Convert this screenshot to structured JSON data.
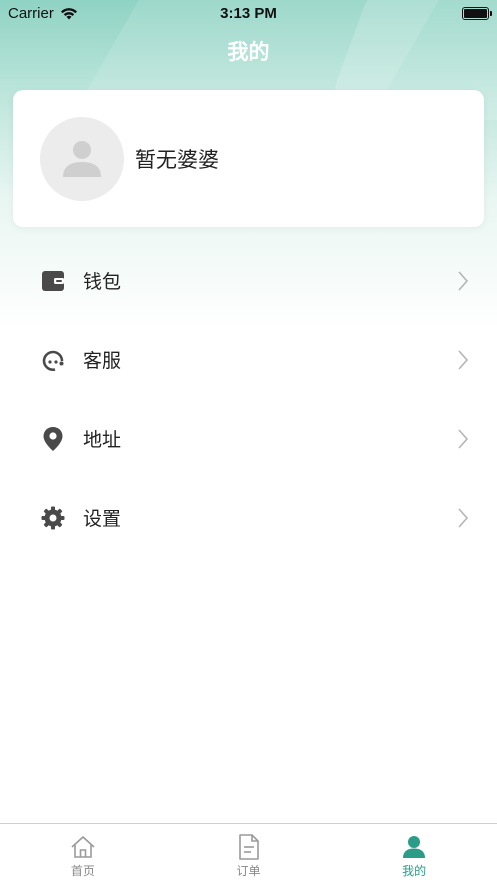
{
  "status_bar": {
    "carrier": "Carrier",
    "time": "3:13 PM"
  },
  "header": {
    "title": "我的"
  },
  "profile": {
    "name": "暂无婆婆",
    "avatar_icon": "person-placeholder-icon"
  },
  "menu": {
    "items": [
      {
        "label": "钱包",
        "icon": "wallet-icon"
      },
      {
        "label": "客服",
        "icon": "customer-service-icon"
      },
      {
        "label": "地址",
        "icon": "location-pin-icon"
      },
      {
        "label": "设置",
        "icon": "gear-icon"
      }
    ]
  },
  "tabbar": {
    "tabs": [
      {
        "label": "首页",
        "icon": "home-icon",
        "active": false
      },
      {
        "label": "订单",
        "icon": "document-icon",
        "active": false
      },
      {
        "label": "我的",
        "icon": "person-icon",
        "active": true
      }
    ]
  },
  "colors": {
    "accent": "#2a9c88",
    "header_gradient_top": "#8fd3c4",
    "icon_dark": "#4a4a4a"
  }
}
